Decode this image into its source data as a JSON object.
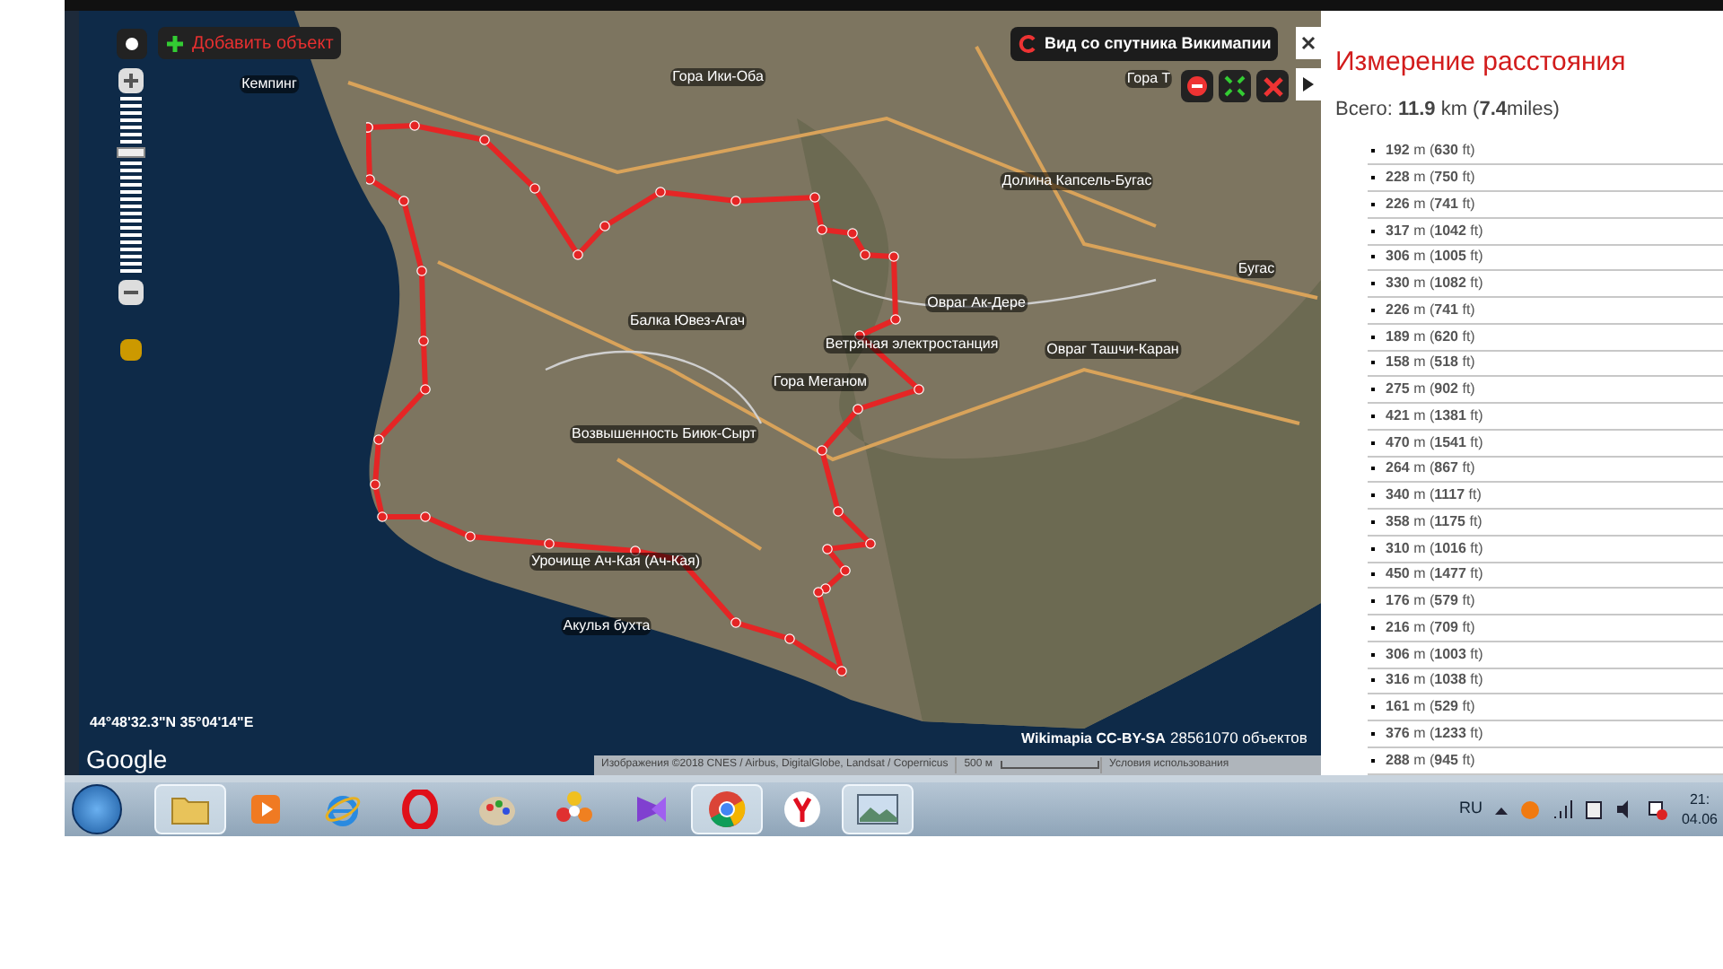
{
  "map": {
    "add_object_button": "Добавить объект",
    "satellite_button": "Вид со спутника Викимапии",
    "zoom": {
      "level": 0.7
    },
    "labels": [
      "Кемпинг",
      "Гора Ики-Оба",
      "Гора Т",
      "Долина Капсель-Бугас",
      "Бугас",
      "Овраг Ак-Дере",
      "Балка Ювез-Агач",
      "Ветряная электростанция",
      "Овраг Ташчи-Каран",
      "Гора Меганом",
      "Возвышенность Биюк-Сырт",
      "Урочище Ач-Кая (Ач-Кая)",
      "Акулья бухта"
    ],
    "coordinates": "44°48'32.3\"N 35°04'14\"E",
    "google_logo": "Google",
    "license": "Wikimapia CC-BY-SA",
    "object_count": "28561070 объектов",
    "attribution": "Изображения ©2018 CNES / Airbus, DigitalGlobe, Landsat / Copernicus",
    "scale": "500 м",
    "terms": "Условия использования"
  },
  "panel": {
    "title": "Измерение расстояния",
    "total": "Всего: **11.9** km (**7.4**miles)",
    "segments": [
      "**192** m (**630** ft)",
      "**228** m (**750** ft)",
      "**226** m (**741** ft)",
      "**317** m (**1042** ft)",
      "**306** m (**1005** ft)",
      "**330** m (**1082** ft)",
      "**226** m (**741** ft)",
      "**189** m (**620** ft)",
      "**158** m (**518** ft)",
      "**275** m (**902** ft)",
      "**421** m (**1381** ft)",
      "**470** m (**1541** ft)",
      "**264** m (**867** ft)",
      "**340** m (**1117** ft)",
      "**358** m (**1175** ft)",
      "**310** m (**1016** ft)",
      "**450** m (**1477** ft)",
      "**176** m (**579** ft)",
      "**216** m (**709** ft)",
      "**306** m (**1003** ft)",
      "**316** m (**1038** ft)",
      "**161** m (**529** ft)",
      "**376** m (**1233** ft)",
      "**288** m (**945** ft)"
    ]
  },
  "taskbar": {
    "apps": [
      {
        "kind": "folder",
        "active": true
      },
      {
        "kind": "player",
        "active": false
      },
      {
        "kind": "ie",
        "active": false
      },
      {
        "kind": "opera",
        "active": false
      },
      {
        "kind": "paint",
        "active": false
      },
      {
        "kind": "flower",
        "active": false
      },
      {
        "kind": "vs",
        "active": false
      },
      {
        "kind": "chrome",
        "active": true
      },
      {
        "kind": "yandex",
        "active": false
      },
      {
        "kind": "photo",
        "active": true
      }
    ],
    "language": "RU",
    "time": "21:",
    "date": "04.06"
  }
}
